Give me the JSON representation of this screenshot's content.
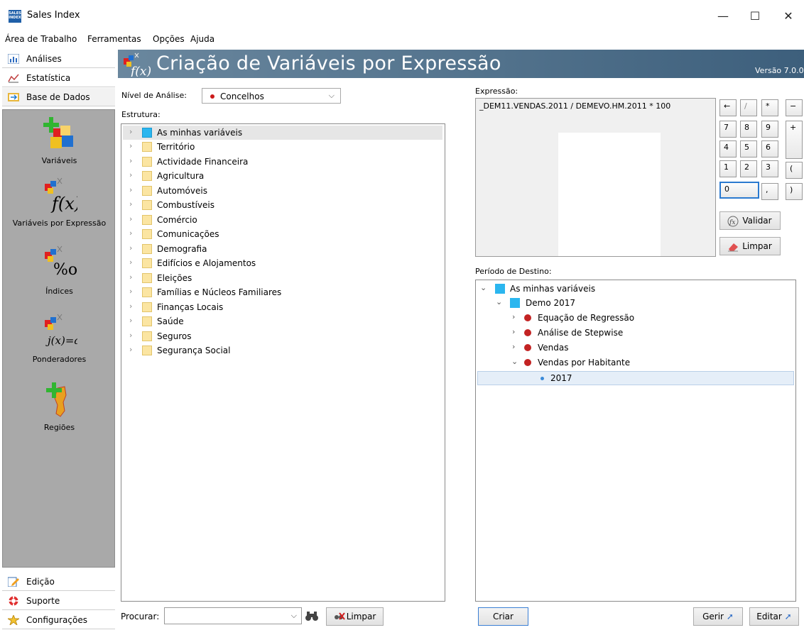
{
  "window": {
    "title": "Sales Index",
    "app_icon_text": "SALES INDEX",
    "minimize": "—",
    "maximize": "☐",
    "close": "✕"
  },
  "menu": [
    {
      "label": "Área de Trabalho"
    },
    {
      "label": "Ferramentas"
    },
    {
      "label": "Opções"
    },
    {
      "label": "Ajuda"
    }
  ],
  "sidebar": {
    "tabs": [
      {
        "label": "Análises",
        "icon": "chart-icon"
      },
      {
        "label": "Estatística",
        "icon": "stats-icon"
      },
      {
        "label": "Base de Dados",
        "icon": "database-icon"
      }
    ],
    "panel_items": [
      {
        "label": "Variáveis",
        "icon": "variables-icon"
      },
      {
        "label": "Variáveis por Expressão",
        "icon": "function-icon"
      },
      {
        "label": "Índices",
        "icon": "index-icon"
      },
      {
        "label": "Ponderadores",
        "icon": "weights-icon"
      },
      {
        "label": "Regiões",
        "icon": "regions-icon"
      }
    ],
    "bottom_tabs": [
      {
        "label": "Edição",
        "icon": "edit-icon"
      },
      {
        "label": "Suporte",
        "icon": "support-icon"
      },
      {
        "label": "Configurações",
        "icon": "star-icon"
      }
    ]
  },
  "header": {
    "title": "Criação de Variáveis por Expressão",
    "version": "Versão 7.0.0"
  },
  "left": {
    "nivel_label": "Nível de Análise:",
    "nivel_value": "Concelhos",
    "estrutura_label": "Estrutura:",
    "tree": [
      "As minhas variáveis",
      "Território",
      "Actividade Financeira",
      "Agricultura",
      "Automóveis",
      "Combustíveis",
      "Comércio",
      "Comunicações",
      "Demografia",
      "Edifícios e Alojamentos",
      "Eleições",
      "Famílias e Núcleos Familiares",
      "Finanças Locais",
      "Saúde",
      "Seguros",
      "Segurança Social"
    ],
    "procurar_label": "Procurar:",
    "procurar_value": "",
    "limpar_label": "Limpar"
  },
  "right": {
    "expressao_label": "Expressão:",
    "expressao": "_DEM11.VENDAS.2011 / DEMEVO.HM.2011 * 100",
    "keys": {
      "back": "←",
      "div": "/",
      "mul": "*",
      "minus": "−",
      "plus": "+",
      "k7": "7",
      "k8": "8",
      "k9": "9",
      "k4": "4",
      "k5": "5",
      "k6": "6",
      "k1": "1",
      "k2": "2",
      "k3": "3",
      "lp": "(",
      "rp": ")",
      "k0": "0",
      "comma": ","
    },
    "validar": "Validar",
    "limpar": "Limpar",
    "periodo_label": "Período de Destino:",
    "tree": {
      "root": "As minhas variáveis",
      "demo": "Demo 2017",
      "items": [
        "Equação de Regressão",
        "Análise de Stepwise",
        "Vendas",
        "Vendas por Habitante"
      ],
      "year": "2017"
    },
    "criar": "Criar",
    "gerir": "Gerir",
    "editar": "Editar"
  },
  "colors": {
    "header_start": "#6a879e",
    "header_end": "#3d5f7c",
    "panel_bg": "#a9a9a9",
    "folder": "#fbe5a2",
    "accent_blue": "#2bb6ef",
    "red_dot": "#c32323"
  }
}
